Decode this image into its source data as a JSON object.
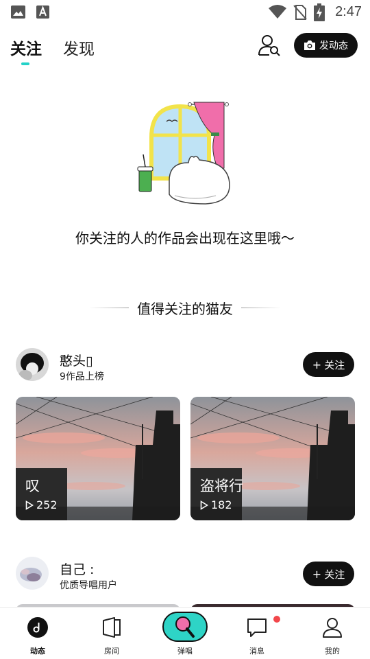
{
  "status_bar": {
    "time": "2:47",
    "icons": [
      "image-icon",
      "font-icon",
      "wifi-icon",
      "no-sim-icon",
      "battery-charging-icon"
    ]
  },
  "header": {
    "tabs": [
      {
        "label": "关注",
        "active": true
      },
      {
        "label": "发现",
        "active": false
      }
    ],
    "user_search_icon": "user-search-icon",
    "post_button_label": "发动态",
    "accent_color": "#23d2c8"
  },
  "empty_state": {
    "illustration_icon": "cat-by-window-illustration",
    "message": "你关注的人的作品会出现在这里哦～"
  },
  "recommend": {
    "title": "值得关注的猫友",
    "users": [
      {
        "name": "憨头▯",
        "subtitle": "9作品上榜",
        "follow_label": "关注",
        "works": [
          {
            "title": "叹",
            "plays": "252"
          },
          {
            "title": "盗将行",
            "plays": "182"
          }
        ]
      },
      {
        "name": "自己 :",
        "subtitle": "优质导唱用户",
        "follow_label": "关注"
      }
    ]
  },
  "bottom_nav": {
    "items": [
      {
        "label": "动态",
        "icon": "music-note-icon",
        "active": true
      },
      {
        "label": "房间",
        "icon": "room-icon",
        "active": false
      },
      {
        "label": "弹唱",
        "icon": "microphone-icon",
        "active": false
      },
      {
        "label": "消息",
        "icon": "message-icon",
        "active": false,
        "badge": true
      },
      {
        "label": "我的",
        "icon": "profile-icon",
        "active": false
      }
    ],
    "badge_color": "#f2474b"
  }
}
